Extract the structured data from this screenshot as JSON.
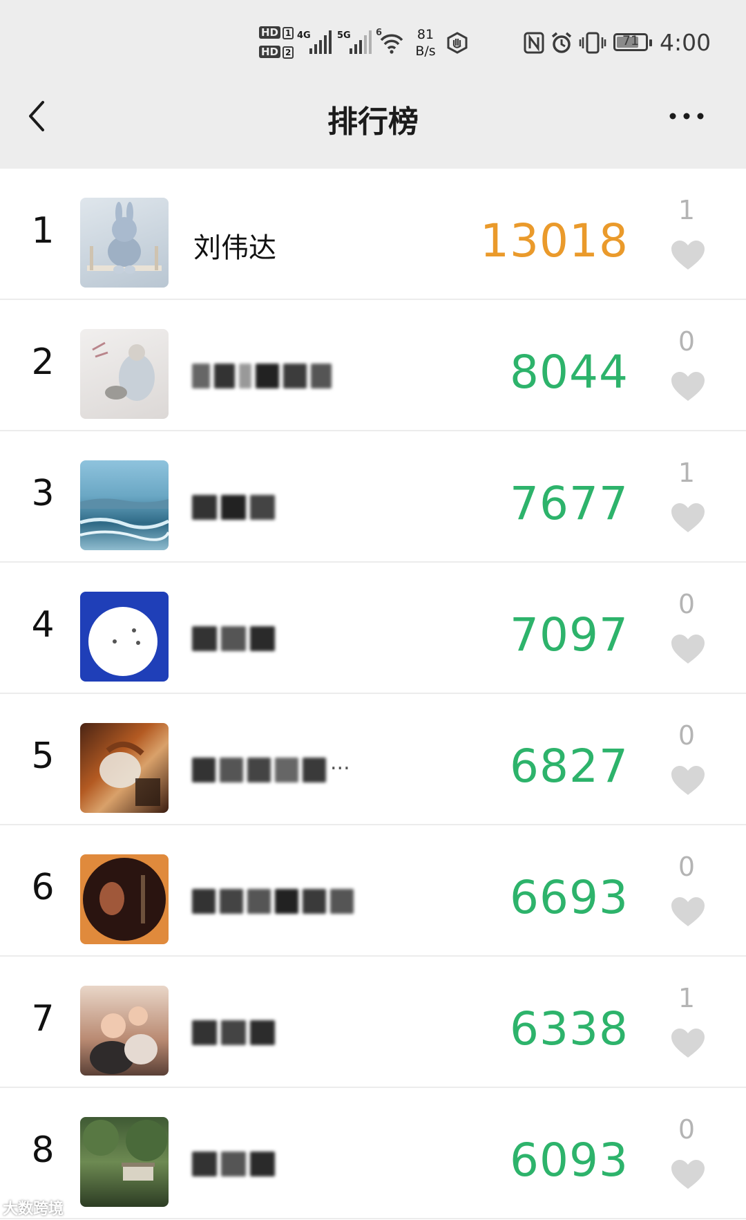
{
  "status_bar": {
    "hd1": "HD",
    "hd1_n": "1",
    "hd2": "HD",
    "hd2_n": "2",
    "sig1_label": "4G",
    "sig2_label": "5G",
    "wifi_label": "6",
    "net_speed_value": "81",
    "net_speed_unit": "B/s",
    "battery": "71",
    "time": "4:00"
  },
  "nav": {
    "back_icon": "chevron-left-icon",
    "title": "排行榜",
    "more_icon": "more-dots-icon"
  },
  "colors": {
    "first_place_score": "#ea9a2b",
    "score": "#2db36b",
    "likes": "#b4b4b4",
    "heart": "#d6d6d6"
  },
  "ranking": [
    {
      "rank": "1",
      "name": "刘伟达",
      "name_blurred": false,
      "score": "13018",
      "likes": "1"
    },
    {
      "rank": "2",
      "name": "",
      "name_blurred": true,
      "score": "8044",
      "likes": "0"
    },
    {
      "rank": "3",
      "name": "",
      "name_blurred": true,
      "score": "7677",
      "likes": "1"
    },
    {
      "rank": "4",
      "name": "",
      "name_blurred": true,
      "score": "7097",
      "likes": "0"
    },
    {
      "rank": "5",
      "name": "...",
      "name_blurred": true,
      "score": "6827",
      "likes": "0"
    },
    {
      "rank": "6",
      "name": "",
      "name_blurred": true,
      "score": "6693",
      "likes": "0"
    },
    {
      "rank": "7",
      "name": "",
      "name_blurred": true,
      "score": "6338",
      "likes": "1"
    },
    {
      "rank": "8",
      "name": "",
      "name_blurred": true,
      "score": "6093",
      "likes": "0"
    }
  ],
  "watermark": "大数跨境"
}
